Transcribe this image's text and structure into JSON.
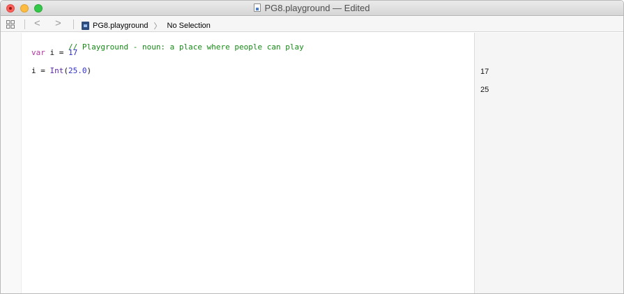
{
  "window": {
    "title": "PG8.playground — Edited"
  },
  "jumpbar": {
    "back_glyph": "<",
    "forward_glyph": ">",
    "file_name": "PG8.playground",
    "chevron": "〉",
    "selection": "No Selection"
  },
  "editor": {
    "line1": {
      "comment": "// Playground - noun: a place where people can play"
    },
    "line2": {
      "keyword": "var",
      "name": " i = ",
      "value": "17"
    },
    "line3": {
      "name": "i = ",
      "type": "Int",
      "open": "(",
      "value": "25.0",
      "close": ")"
    }
  },
  "results": {
    "r1": "17",
    "r2": "25"
  },
  "icons": {
    "grid": "grid-icon",
    "file": "playground-file-icon",
    "document": "document-icon"
  },
  "colors": {
    "comment": "#148a14",
    "keyword": "#b3359e",
    "number": "#2f2fc8",
    "type": "#5c26a8"
  }
}
